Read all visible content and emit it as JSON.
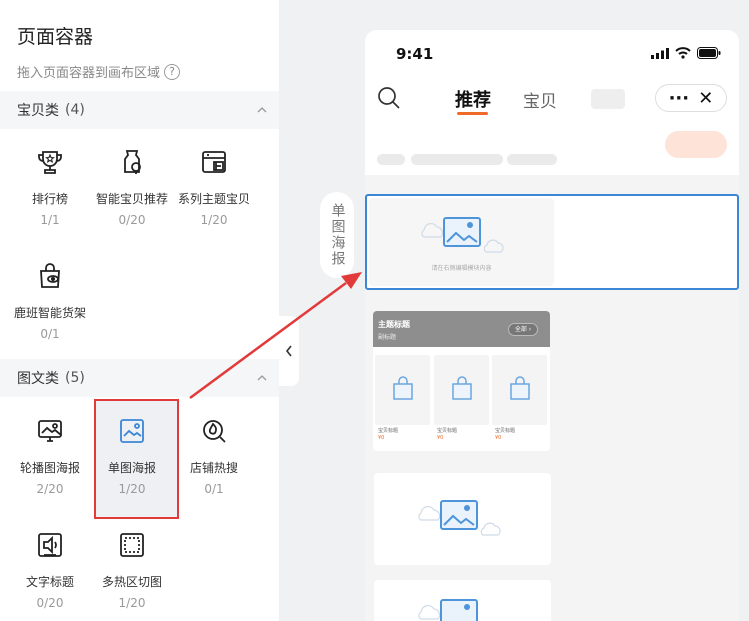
{
  "panel": {
    "title": "页面容器",
    "subtitle": "拖入页面容器到画布区域",
    "help_glyph": "?"
  },
  "sections": [
    {
      "name": "宝贝类",
      "count": "(4)",
      "items": [
        {
          "label": "排行榜",
          "count": "1/1",
          "icon": "trophy-icon"
        },
        {
          "label": "智能宝贝推荐",
          "count": "0/20",
          "icon": "smart-product-icon"
        },
        {
          "label": "系列主题宝贝",
          "count": "1/20",
          "icon": "shop-series-icon"
        },
        {
          "label": "鹿班智能货架",
          "count": "0/1",
          "icon": "smart-shelf-icon"
        }
      ]
    },
    {
      "name": "图文类",
      "count": "(5)",
      "items": [
        {
          "label": "轮播图海报",
          "count": "2/20",
          "icon": "carousel-poster-icon"
        },
        {
          "label": "单图海报",
          "count": "1/20",
          "icon": "single-poster-icon"
        },
        {
          "label": "店铺热搜",
          "count": "0/1",
          "icon": "hot-search-icon"
        },
        {
          "label": "文字标题",
          "count": "0/20",
          "icon": "text-title-icon"
        },
        {
          "label": "多热区切图",
          "count": "1/20",
          "icon": "multi-hotspot-icon"
        }
      ]
    }
  ],
  "drag_label": "单图海报",
  "phone": {
    "time": "9:41",
    "tabs": [
      "推荐",
      "宝贝"
    ],
    "capsule_more": "···",
    "capsule_close": "✕",
    "single_poster_hint": "请在右侧编辑模块内容",
    "theme": {
      "title": "主题标题",
      "subtitle": "副标题",
      "all": "全部 ›",
      "products": [
        {
          "title": "宝贝标题",
          "price": "¥0"
        },
        {
          "title": "宝贝标题",
          "price": "¥0"
        },
        {
          "title": "宝贝标题",
          "price": "¥0"
        }
      ]
    }
  },
  "colors": {
    "accent_blue": "#3b86d6",
    "highlight_red": "#e23a3a",
    "tab_orange": "#f06a2a"
  }
}
